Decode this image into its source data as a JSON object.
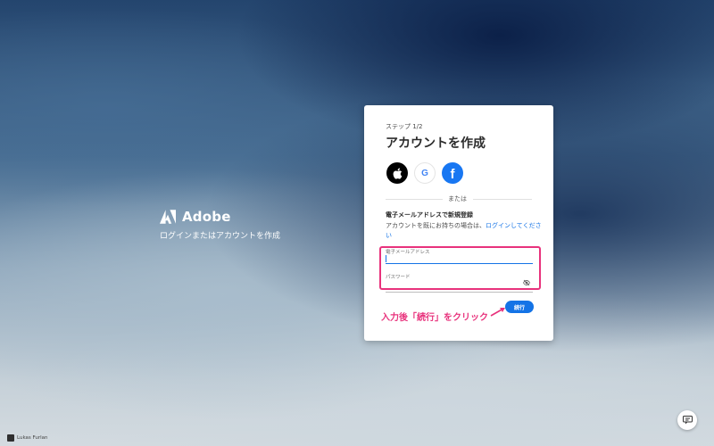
{
  "brand": {
    "name": "Adobe",
    "tagline": "ログインまたはアカウントを作成",
    "logo_icon": "adobe-logo-icon"
  },
  "card": {
    "step": "ステップ 1/2",
    "title": "アカウントを作成",
    "social": [
      {
        "name": "apple",
        "icon": "apple-icon"
      },
      {
        "name": "google",
        "icon": "google-icon",
        "glyph": "G"
      },
      {
        "name": "facebook",
        "icon": "facebook-icon",
        "glyph": "f"
      }
    ],
    "divider_text": "または",
    "email_heading": "電子メールアドレスで新規登録",
    "signin_prompt": "アカウントを既にお持ちの場合は、",
    "signin_link": "ログインしてください",
    "email_label": "電子メールアドレス",
    "password_label": "パスワード",
    "continue_label": "続行"
  },
  "annotation": {
    "text": "入力後「続行」をクリック",
    "color": "#e8327c"
  },
  "colors": {
    "accent": "#1473e6",
    "facebook": "#1877f2",
    "highlight": "#e8327c"
  },
  "credit": {
    "text": "Lukas Furlan"
  },
  "chat": {
    "icon": "chat-icon"
  }
}
